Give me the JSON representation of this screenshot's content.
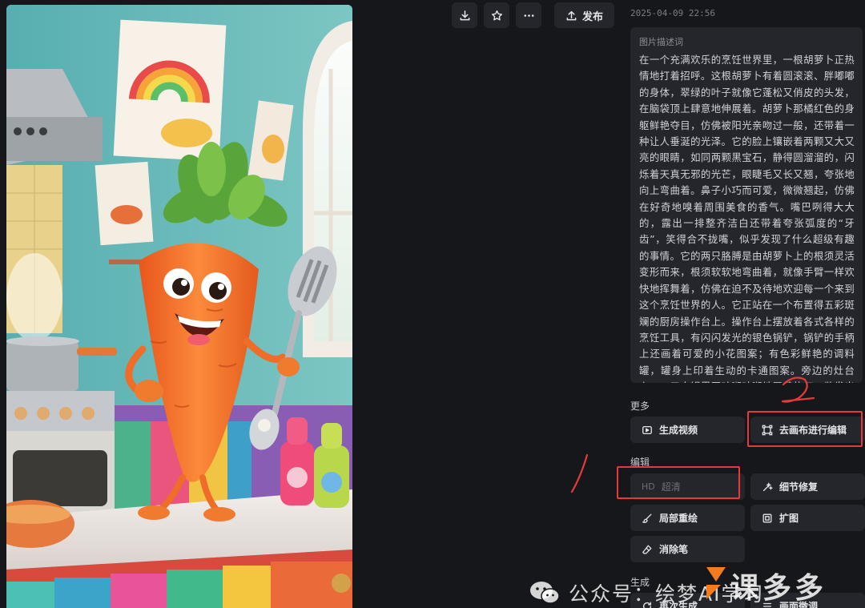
{
  "toolbar": {
    "download_icon": "download-icon",
    "favorite_icon": "star-icon",
    "more_icon": "ellipsis-icon",
    "publish_label": "发布"
  },
  "timestamp": "2025-04-09 22:56",
  "description": {
    "label": "图片描述词",
    "text": "在一个充满欢乐的烹饪世界里，一根胡萝卜正热情地打着招呼。这根胡萝卜有着圆滚滚、胖嘟嘟的身体，翠绿的叶子就像它蓬松又俏皮的头发，在脑袋顶上肆意地伸展着。胡萝卜那橘红色的身躯鲜艳夺目，仿佛被阳光亲吻过一般，还带着一种让人垂涎的光泽。它的脸上镶嵌着两颗又大又亮的眼睛，如同两颗黑宝石，静得圆溜溜的，闪烁着天真无邪的光芒，眼睫毛又长又翘，夸张地向上弯曲着。鼻子小巧而可爱，微微翘起，仿佛在好奇地嗅着周围美食的香气。嘴巴咧得大大的，露出一排整齐洁白还带着夸张弧度的“牙齿”，笑得合不拢嘴，似乎发现了什么超级有趣的事情。它的两只胳膊是由胡萝卜上的根须灵活变形而来，根须软软地弯曲着，就像手臂一样欢快地挥舞着，仿佛在迫不及待地欢迎每一个来到这个烹饪世界的人。它正站在一个布置得五彩斑斓的厨房操作台上。操作台上摆放着各式各样的烹饪工具，有闪闪发光的银色锅铲，锅铲的手柄上还画着可爱的小花图案；有色彩鲜艳的调料罐，罐身上印着生动的卡通图案。旁边的灶台上，一口大锅里正咕嘟咕嘟地冒着热气，散发出阵阵诱人的香气，似乎正在煮着美味的胡萝卜汤。厨房的墙壁上贴着色彩缤纷的美食海报，窗"
  },
  "sections": {
    "more": "更多",
    "edit": "编辑",
    "generate": "生成"
  },
  "actions": {
    "generate_video": "生成视频",
    "canvas_edit": "去画布进行编辑",
    "hd_tag": "HD",
    "upscale": "超清",
    "detail_repair": "细节修复",
    "local_repaint": "局部重绘",
    "outpaint": "扩图",
    "eraser": "消除笔",
    "regenerate": "再次生成",
    "extra": "画面微调"
  },
  "annotations": {
    "mark_1": "1",
    "mark_2": "2"
  },
  "watermark": {
    "text": "公众号：绘梦AI学习",
    "brand_text": "课多多"
  },
  "colors": {
    "background": "#16171b",
    "panel": "#24262c",
    "annotation": "#e53a3a"
  }
}
